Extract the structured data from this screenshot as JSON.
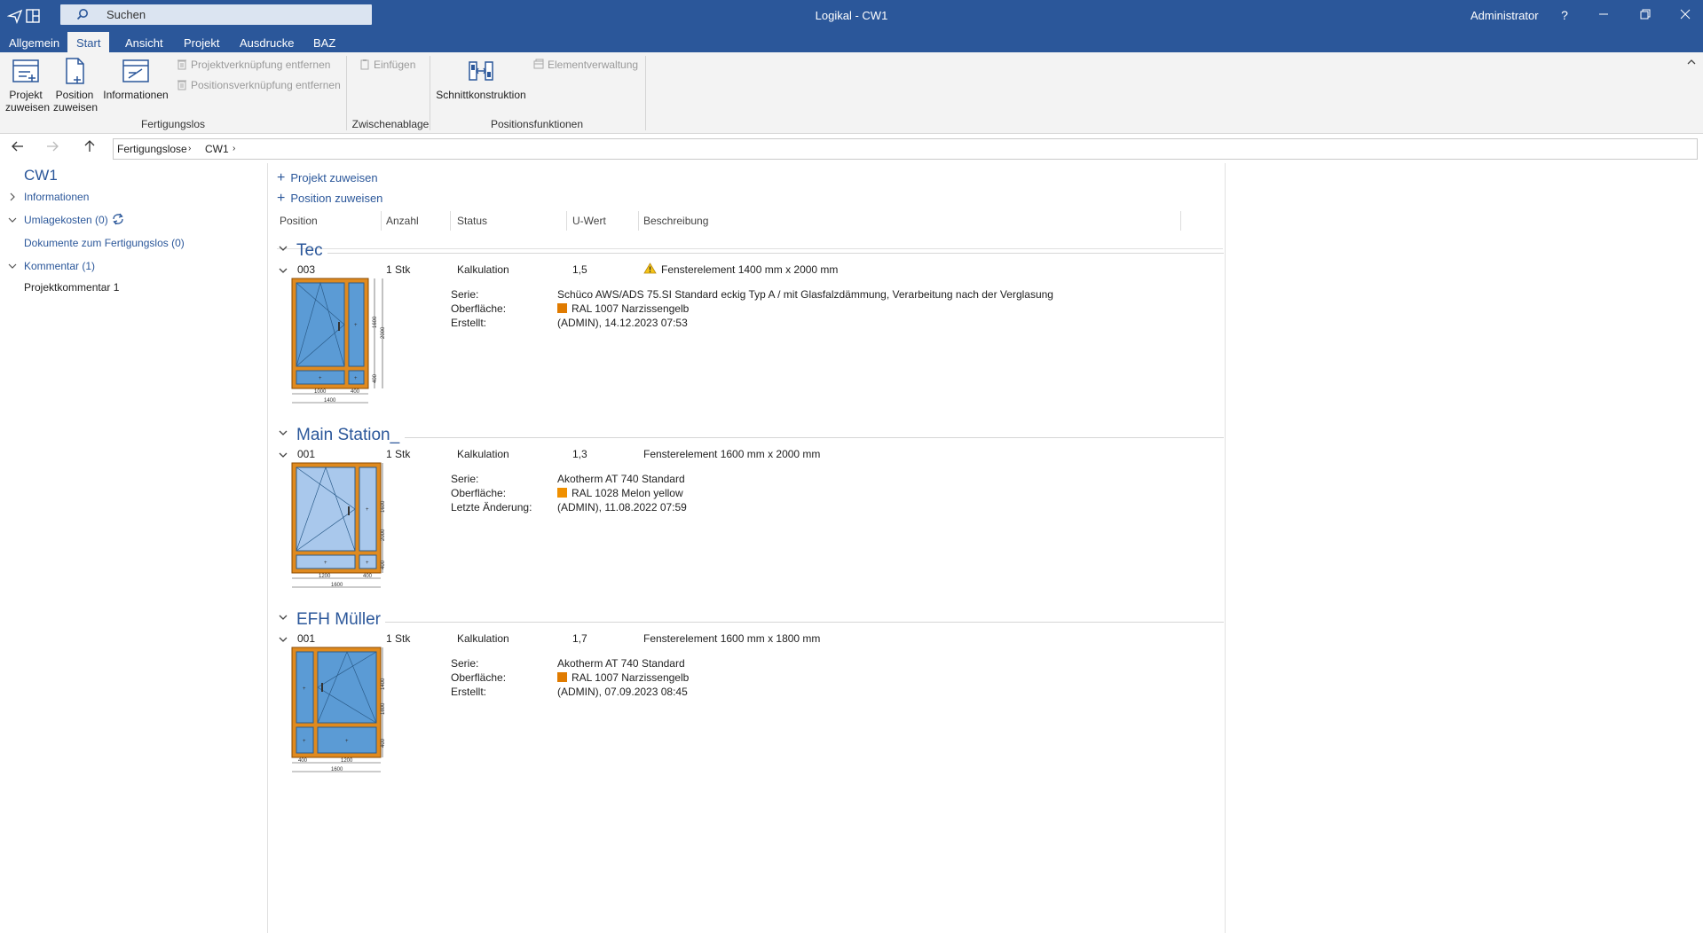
{
  "titlebar": {
    "search_placeholder": "Suchen",
    "window_title": "Logikal - CW1",
    "user": "Administrator",
    "help": "?",
    "accent": "#2b579a"
  },
  "tabs": [
    {
      "label": "Allgemein"
    },
    {
      "label": "Start",
      "active": true
    },
    {
      "label": "Ansicht"
    },
    {
      "label": "Projekt"
    },
    {
      "label": "Ausdrucke"
    },
    {
      "label": "BAZ"
    }
  ],
  "ribbon": {
    "fertigungslos": {
      "projekt_zuweisen_1": "Projekt",
      "projekt_zuweisen_2": "zuweisen",
      "position_zuweisen_1": "Position",
      "position_zuweisen_2": "zuweisen",
      "informationen": "Informationen",
      "projektverknuepfung": "Projektverknüpfung entfernen",
      "positionsverknuepfung": "Positionsverknüpfung entfernen",
      "group_label": "Fertigungslos"
    },
    "zwischenablage": {
      "einfuegen": "Einfügen",
      "group_label": "Zwischenablage"
    },
    "positionsfunktionen": {
      "schnittkonstruktion": "Schnittkonstruktion",
      "elementverwaltung": "Elementverwaltung",
      "group_label": "Positionsfunktionen"
    }
  },
  "breadcrumb": {
    "items": [
      "Fertigungslose",
      "CW1"
    ]
  },
  "sidebar": {
    "title": "CW1",
    "informationen": "Informationen",
    "umlagekosten": "Umlagekosten (0)",
    "dokumente": "Dokumente zum Fertigungslos (0)",
    "kommentar": "Kommentar (1)",
    "projektkommentar": "Projektkommentar 1"
  },
  "main": {
    "projekt_zuweisen": "Projekt zuweisen",
    "position_zuweisen": "Position zuweisen",
    "columns": {
      "position": "Position",
      "anzahl": "Anzahl",
      "status": "Status",
      "uwert": "U-Wert",
      "beschreibung": "Beschreibung"
    },
    "groups": [
      {
        "title": "Tec",
        "position": "003",
        "anzahl": "1 Stk",
        "status": "Kalkulation",
        "uwert": "1,5",
        "beschreibung": "Fensterelement 1400 mm x 2000 mm",
        "warning": true,
        "serie_label": "Serie:",
        "serie": "Schüco AWS/ADS 75.SI Standard eckig Typ A / mit Glasfalzdämmung, Verarbeitung nach der Verglasung",
        "oberflaeche_label": "Oberfläche:",
        "oberflaeche": "RAL 1007 Narzissengelb",
        "oberflaeche_color": "#e07b00",
        "date_label": "Erstellt:",
        "date": "(ADMIN), 14.12.2023 07:53",
        "dims": {
          "w1": "1000",
          "w2": "400",
          "w": "1400",
          "h1": "1600",
          "h2": "400",
          "h": "2000"
        }
      },
      {
        "title": "Main Station_",
        "position": "001",
        "anzahl": "1 Stk",
        "status": "Kalkulation",
        "uwert": "1,3",
        "beschreibung": "Fensterelement 1600 mm x 2000 mm",
        "warning": false,
        "serie_label": "Serie:",
        "serie": "Akotherm AT 740 Standard",
        "oberflaeche_label": "Oberfläche:",
        "oberflaeche": "RAL 1028 Melon yellow",
        "oberflaeche_color": "#f09000",
        "date_label": "Letzte Änderung:",
        "date": "(ADMIN), 11.08.2022 07:59",
        "dims": {
          "w1": "1200",
          "w2": "400",
          "w": "1600",
          "h1": "1600",
          "h2": "400",
          "h": "2000"
        }
      },
      {
        "title": "EFH Müller",
        "position": "001",
        "anzahl": "1 Stk",
        "status": "Kalkulation",
        "uwert": "1,7",
        "beschreibung": "Fensterelement 1600 mm x 1800 mm",
        "warning": false,
        "serie_label": "Serie:",
        "serie": "Akotherm AT 740 Standard",
        "oberflaeche_label": "Oberfläche:",
        "oberflaeche": "RAL 1007 Narzissengelb",
        "oberflaeche_color": "#e07b00",
        "date_label": "Erstellt:",
        "date": "(ADMIN), 07.09.2023 08:45",
        "dims": {
          "w1": "400",
          "w2": "1200",
          "w": "1600",
          "h1": "1400",
          "h2": "400",
          "h": "1800"
        }
      }
    ]
  }
}
